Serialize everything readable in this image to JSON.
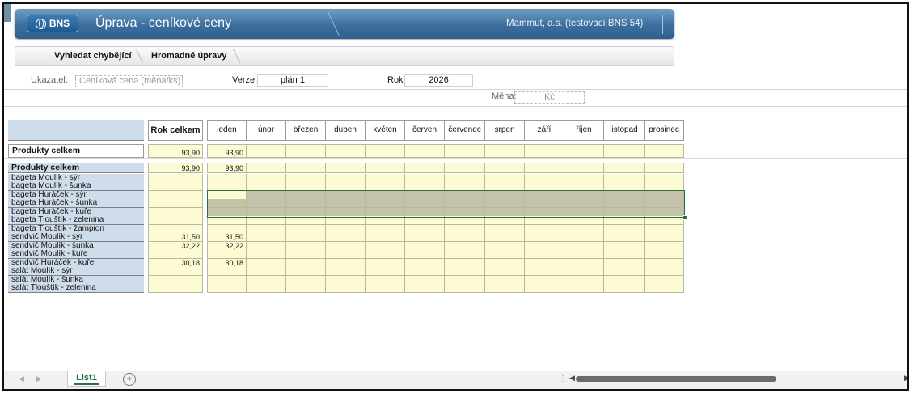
{
  "header": {
    "logo_text": "BNS",
    "title": "Úprava - ceníkové ceny",
    "company": "Mammut, a.s. (testovací BNS 54)"
  },
  "toolbar": {
    "find_missing": "Vyhledat chybějící",
    "bulk_edit": "Hromadné úpravy"
  },
  "params": {
    "indicator_label": "Ukazatel:",
    "indicator_value": "Ceníková cena (měna/ks)",
    "version_label": "Verze:",
    "version_value": "plán 1",
    "year_label": "Rok:",
    "year_value": "2026",
    "currency_label": "Měna:",
    "currency_value": "Kč"
  },
  "table": {
    "total_header": "Rok celkem",
    "months": [
      "leden",
      "únor",
      "březen",
      "duben",
      "květen",
      "červen",
      "červenec",
      "srpen",
      "září",
      "říjen",
      "listopad",
      "prosinec"
    ],
    "summary_row": {
      "label": "Produkty celkem",
      "total": "93,90",
      "months": [
        "93,90",
        "",
        "",
        "",
        "",
        "",
        "",
        "",
        "",
        "",
        "",
        ""
      ]
    },
    "rows": [
      {
        "label": "Produkty celkem",
        "bold": true,
        "total": "93,90",
        "leden": "93,90"
      },
      {
        "label": "bageta Moulík - sýr",
        "total": "",
        "leden": ""
      },
      {
        "label": "bageta Moulík - šunka",
        "total": "",
        "leden": ""
      },
      {
        "label": "bageta Huráček - sýr",
        "total": "",
        "leden": ""
      },
      {
        "label": "bageta Huráček - šunka",
        "total": "",
        "leden": ""
      },
      {
        "label": "bageta Huráček - kuře",
        "total": "",
        "leden": ""
      },
      {
        "label": "bageta Tlouštík - zelenina",
        "total": "",
        "leden": ""
      },
      {
        "label": "bageta Tlouštík - žampion",
        "total": "",
        "leden": ""
      },
      {
        "label": "sendvič Moulík - sýr",
        "total": "31,50",
        "leden": "31,50"
      },
      {
        "label": "sendvič Moulík - šunka",
        "total": "32,22",
        "leden": "32,22"
      },
      {
        "label": "sendvič Moulík - kuře",
        "total": "",
        "leden": ""
      },
      {
        "label": "sendvič Huráček - kuře",
        "total": "30,18",
        "leden": "30,18"
      },
      {
        "label": "salát Moulík - sýr",
        "total": "",
        "leden": ""
      },
      {
        "label": "salát Moulík - šunka",
        "total": "",
        "leden": ""
      },
      {
        "label": "salát Tlouštík - zelenina",
        "total": "",
        "leden": ""
      }
    ]
  },
  "sheet_tabs": {
    "active": "List1",
    "add_symbol": "+"
  },
  "colors": {
    "header_blue": "#3c6f9e",
    "label_blue": "#cfdcec",
    "cell_yellow": "#fdfbd3",
    "selection_grey": "#c4c2a9",
    "excel_green": "#217346"
  }
}
